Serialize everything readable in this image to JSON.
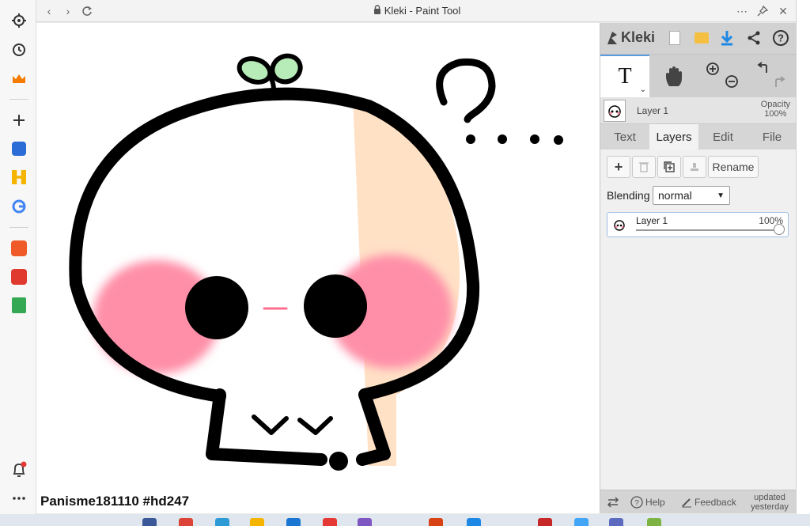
{
  "window": {
    "title": "Kleki - Paint Tool"
  },
  "caption": "Panisme181110 #hd247",
  "panel": {
    "brand": "Kleki",
    "layer_strip": {
      "layer_label": "Layer 1",
      "opacity_label": "Opacity",
      "opacity_value": "100%"
    },
    "tabs": [
      "Text",
      "Layers",
      "Edit",
      "File"
    ],
    "active_tab": "Layers",
    "layers_tab": {
      "rename_label": "Rename",
      "blending_label": "Blending",
      "blending_value": "normal",
      "layers": [
        {
          "name": "Layer 1",
          "opacity": "100%",
          "opacity_fraction": 1.0
        }
      ]
    },
    "bottom": {
      "help_label": "Help",
      "feedback_label": "Feedback",
      "updated_line1": "updated",
      "updated_line2": "yesterday"
    }
  },
  "colors": {
    "accent": "#5b9be0",
    "blush": "#ff8fa8",
    "sprout": "#b7ecb8",
    "peach": "#ffe1c6"
  },
  "icons": {
    "left_rail": [
      "gear-icon",
      "history-icon",
      "crown-icon",
      "plus-icon",
      "app-icon-blue",
      "app-icon-yellow",
      "google-icon",
      "shopee-icon",
      "app-icon-red",
      "sheets-icon",
      "bell-icon",
      "more-icon"
    ],
    "titlebar": [
      "back-icon",
      "forward-icon",
      "reload-icon",
      "lock-icon",
      "more-icon",
      "pin-icon",
      "close-icon"
    ],
    "toolbar": [
      "new-file-icon",
      "open-folder-icon",
      "download-icon",
      "share-icon",
      "help-icon"
    ],
    "tools": [
      "text-tool-icon",
      "hand-tool-icon",
      "zoom-in-icon",
      "zoom-out-icon",
      "undo-icon",
      "redo-icon"
    ]
  }
}
